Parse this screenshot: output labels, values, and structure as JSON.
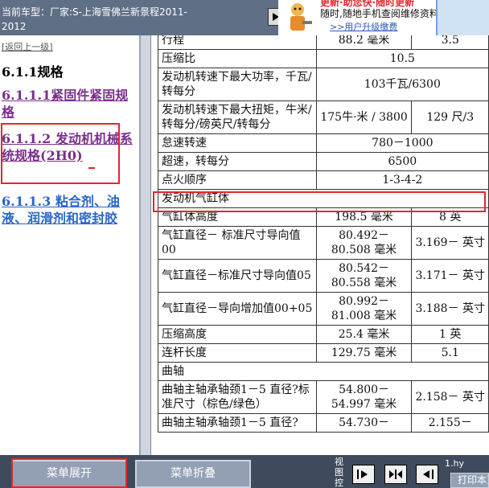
{
  "header": {
    "vehicle_line1": "当前车型：厂家:S-上海雪佛兰新景程2011-",
    "vehicle_line2": "2012",
    "promo_title": "更新·助您快·随时更新",
    "promo_line": "随时,随地手机查阅维修资料",
    "promo_link": ">>用户升级缴费"
  },
  "nav": {
    "back_link": "[返回上一级]",
    "heading": "6.1.1规格",
    "items": [
      {
        "label": "6.1.1.1紧固件紧固规格"
      },
      {
        "label": "6.1.1.2 发动机机械系统规格(2H0)"
      },
      {
        "label": "6.1.1.3 粘合剂、油液、润滑剂和密封胶"
      }
    ]
  },
  "table": {
    "rows": [
      {
        "c1": "行程",
        "c2": "88.2 毫米",
        "c3": "3.5"
      },
      {
        "c1": "压缩比",
        "span": "10.5"
      },
      {
        "c1": "发动机转速下最大功率，千瓦/转每分",
        "span": "103千瓦/6300"
      },
      {
        "c1": "发动机转速下最大扭矩，牛米/转每分/磅英尺/转每分",
        "c2": "175牛·米 / 3800",
        "c3": "129 尺/3"
      },
      {
        "c1": "怠速转速",
        "span": "780－1000"
      },
      {
        "c1": "超速，转每分",
        "span": "6500"
      },
      {
        "c1": "点火顺序",
        "span": "1-3-4-2"
      },
      {
        "section": "发动机气缸体"
      },
      {
        "c1": "气缸体高度",
        "c2": "198.5 毫米",
        "c3": "8 英"
      },
      {
        "c1": "气缸直径－ 标准尺寸导向值00",
        "c2": "80.492－ 80.508 毫米",
        "c3": "3.169－ 英寸"
      },
      {
        "c1": "气缸直径－标准尺寸导向值05",
        "c2": "80.542－ 80.558 毫米",
        "c3": "3.171－ 英寸"
      },
      {
        "c1": "气缸直径－导向增加值00+05",
        "c2": "80.992－ 81.008 毫米",
        "c3": "3.188－ 英寸"
      },
      {
        "c1": "压缩高度",
        "c2": "25.4 毫米",
        "c3": "1 英"
      },
      {
        "c1": "连杆长度",
        "c2": "129.75 毫米",
        "c3": "5.1"
      },
      {
        "section": "曲轴"
      },
      {
        "c1": "曲轴主轴承轴颈1－5 直径?标准尺寸（棕色/绿色）",
        "c2": "54.800－ 54.997 毫米",
        "c3": "2.158－ 英寸"
      },
      {
        "c1": "曲轴主轴承轴颈1－5 直径?",
        "c2": "54.730－",
        "c3": "2.155－"
      }
    ]
  },
  "footer": {
    "expand_label": "菜单展开",
    "collapse_label": "菜单折叠",
    "view_label": "视图控",
    "hy_label": "1.hy",
    "print_label": "打印本页"
  }
}
